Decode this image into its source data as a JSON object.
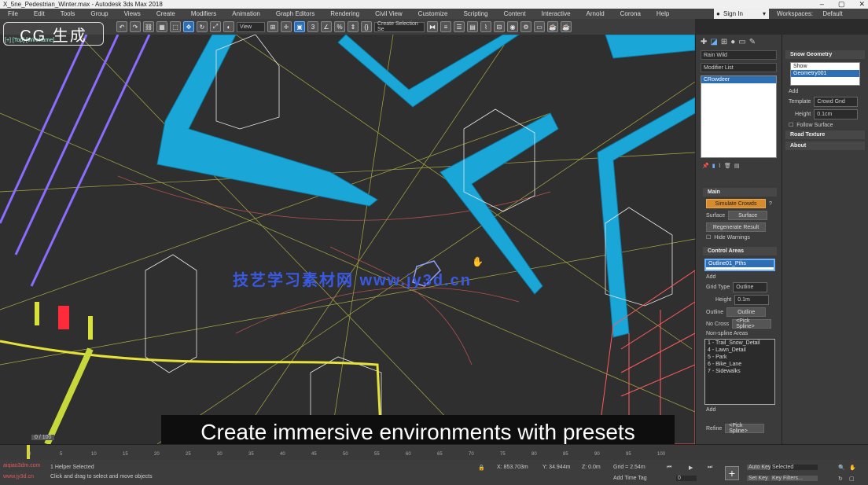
{
  "window": {
    "title": "X_5ne_Pedestrian_Winter.max - Autodesk 3ds Max 2018"
  },
  "menu": [
    "File",
    "Edit",
    "Tools",
    "Group",
    "Views",
    "Create",
    "Modifiers",
    "Animation",
    "Graph Editors",
    "Rendering",
    "Civil View",
    "Customize",
    "Scripting",
    "Content",
    "Interactive",
    "Arnold",
    "Corona",
    "Help"
  ],
  "signin": "Sign In",
  "workspace": {
    "label": "Workspaces:",
    "value": "Default"
  },
  "logo_text": "CG 生成",
  "toolbar": {
    "view_dropdown": "View",
    "selection_set": "Create Selection Se"
  },
  "viewport": {
    "label": "[+] [Top] [Wireframe]"
  },
  "watermark": "技艺学习素材网 www.jy3d.cn",
  "subtitle": "Create immersive environments with presets",
  "command_panel": {
    "name_field": "Rain Wild",
    "modifier_list": "Modifier List",
    "stack_item": "CRowdeer",
    "main_section": "Main",
    "simulate_button": "Simulate Crowds",
    "surface_label": "Surface",
    "surface_button": "Surface",
    "regenerate_button": "Regenerate Result",
    "hide_warnings": "Hide Warnings",
    "control_areas": "Control Areas",
    "area_selected": "Outline01_Pths",
    "add_label": "Add",
    "grid_type_label": "Grid Type",
    "grid_type_value": "Outline",
    "height_label": "Height",
    "height_value": "0.1m",
    "outline_label": "Outline",
    "outline_button": "Outline",
    "no_cross_label": "No Cross",
    "no_cross_button": "<Pick Spline>",
    "inner_areas_label": "Non-spline Areas",
    "areas": [
      "1 - Trail_Snow_Detail",
      "4 - Lawn_Detail",
      "5 - Park",
      "6 - Bike_Lane",
      "7 - Sidewalks"
    ],
    "add_bottom": "Add",
    "refine_label": "Refine",
    "refine_button": "<Pick Spline>"
  },
  "snow_panel": {
    "title": "Snow Geometry",
    "items": [
      "Show",
      "Geometry001"
    ],
    "add_label": "Add",
    "template_label": "Template",
    "template_value": "Crowd Gnd",
    "height_label": "Height",
    "height_value": "0.1cm",
    "follow_surface": "Follow Surface",
    "section_texture": "Road Texture",
    "section_about": "About"
  },
  "timeline": {
    "frame": "0 / 100",
    "ticks": [
      "0",
      "5",
      "10",
      "15",
      "20",
      "25",
      "30",
      "35",
      "40",
      "45",
      "50",
      "55",
      "60",
      "65",
      "70",
      "75",
      "80",
      "85",
      "90",
      "95",
      "100"
    ]
  },
  "status": {
    "selected": "1 Helper Selected",
    "prompt": "Click and drag to select and move objects",
    "x": "X: 853.703m",
    "y": "Y: 34.944m",
    "z": "Z: 0.0m",
    "grid": "Grid = 2.54m",
    "add_time_tag": "Add Time Tag",
    "selected_dd": "Selected",
    "key_filters": "Key Filters...",
    "auto_key": "Auto Key",
    "set_key": "Set Key",
    "frame_field": "0",
    "site_label": "aiqiao3dm.com",
    "site_url": "www.jy3d.cn"
  },
  "colors": {
    "accent": "#2e6fb3",
    "orange": "#d68b2e",
    "cyan_geo": "#1aa7d8",
    "red_geo": "#ff5a5a"
  }
}
